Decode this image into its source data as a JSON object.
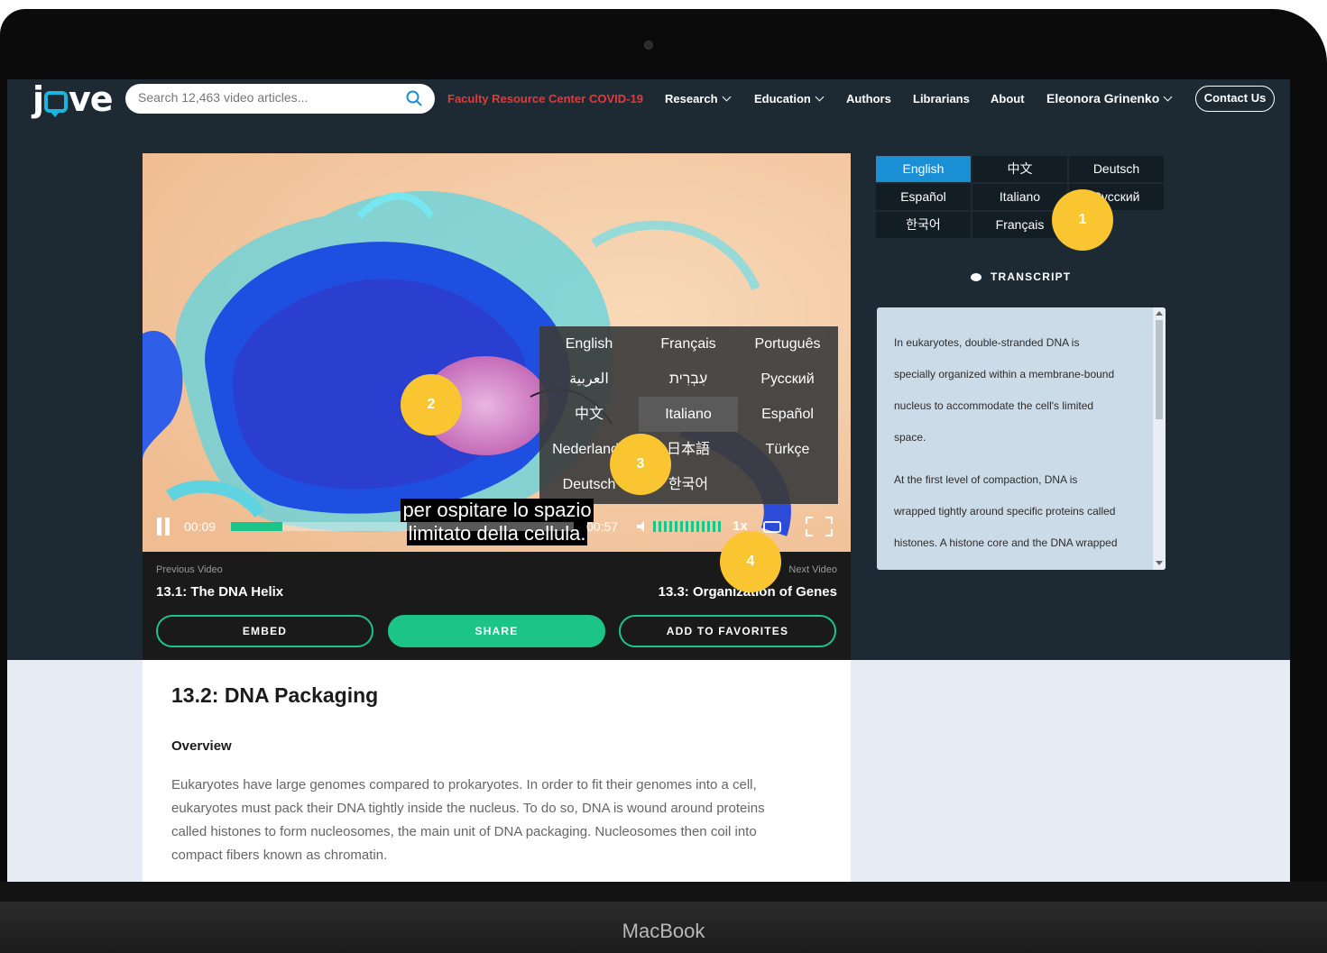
{
  "device": {
    "brand": "MacBook"
  },
  "header": {
    "logo": "jove",
    "search_placeholder": "Search 12,463 video articles...",
    "links": {
      "faculty": "Faculty Resource Center",
      "covid": "COVID-19",
      "research": "Research",
      "education": "Education",
      "authors": "Authors",
      "librarians": "Librarians",
      "about": "About",
      "user": "Eleonora Grinenko"
    },
    "contact": "Contact Us"
  },
  "player": {
    "current_time": "00:09",
    "duration": "00:57",
    "progress_fraction": 0.15,
    "speed": "1x",
    "subtitle_line1": "per ospitare lo spazio",
    "subtitle_line2": "limitato della cellula.",
    "language_menu": [
      [
        "English",
        "Français",
        "Português"
      ],
      [
        "العربية",
        "עִבְרִית",
        "Русский"
      ],
      [
        "中文",
        "Italiano",
        "Español"
      ],
      [
        "Nederlands",
        "日本語",
        "Türkçe"
      ],
      [
        "Deutsch",
        "한국어",
        ""
      ]
    ],
    "language_menu_selected": "Italiano"
  },
  "navigation": {
    "prev_label": "Previous Video",
    "prev_title": "13.1: The DNA Helix",
    "next_label": "Next Video",
    "next_title": "13.3: Organization of Genes"
  },
  "actions": {
    "embed": "EMBED",
    "share": "SHARE",
    "favorites": "ADD TO FAVORITES"
  },
  "transcript_languages": [
    [
      "English",
      "中文",
      "Deutsch"
    ],
    [
      "Español",
      "Italiano",
      "Русский"
    ],
    [
      "한국어",
      "Français",
      ""
    ]
  ],
  "transcript_selected": "English",
  "transcript": {
    "heading": "TRANSCRIPT",
    "lines": [
      "In eukaryotes, double-stranded DNA is",
      "specially organized within a membrane-bound",
      "nucleus to accommodate the cell's limited",
      "space.",
      "At the first level of compaction, DNA is",
      "wrapped tightly around specific proteins called",
      "histones. A histone core and the DNA wrapped"
    ]
  },
  "article": {
    "title": "13.2: DNA Packaging",
    "section": "Overview",
    "body": "Eukaryotes have large genomes compared to prokaryotes. In order to fit their genomes into a cell, eukaryotes must pack their DNA tightly inside the nucleus. To do so, DNA is wound around proteins called histones to form nucleosomes, the main unit of DNA packaging. Nucleosomes then coil into compact fibers known as chromatin."
  },
  "callouts": [
    "1",
    "2",
    "3",
    "4"
  ],
  "colors": {
    "accent_green": "#1dc48a",
    "accent_blue": "#1a8fd6",
    "alert_red": "#e03a3a",
    "callout_yellow": "#f9c531",
    "header_bg": "#1e2a33"
  }
}
